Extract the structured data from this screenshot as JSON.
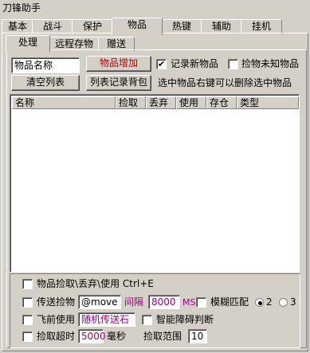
{
  "window": {
    "title": "刀锋助手"
  },
  "main_tabs": [
    "基本",
    "战斗",
    "保护",
    "物品",
    "热键",
    "辅助",
    "挂机"
  ],
  "active_main_tab": "物品",
  "sub_tabs": [
    "处理",
    "远程存物",
    "赠送"
  ],
  "active_sub_tab": "处理",
  "item_panel": {
    "item_name_value": "物品名称",
    "add_item_label": "物品增加",
    "record_new_label": "记录新物品",
    "record_new_checked": true,
    "pickup_unknown_label": "捡物未知物品",
    "pickup_unknown_checked": false,
    "clear_list_label": "清空列表",
    "list_record_bag_label": "列表记录背包",
    "hint_text": "选中物品右键可以删除选中物品"
  },
  "table": {
    "columns": [
      "名称",
      "捡取",
      "丢弃",
      "使用",
      "存仓",
      "类型"
    ],
    "rows": []
  },
  "options": {
    "pickup_discard_use_label": "物品捡取\\丢弃\\使用 Ctrl+E",
    "teleport_pickup_label": "传送捡物",
    "move_cmd_value": "@move",
    "interval_label": "间隔",
    "interval_value": "8000",
    "ms_label": "MS",
    "fuzzy_match_label": "模糊匹配",
    "radio_2_label": "2",
    "radio_3_label": "3",
    "fly_before_use_label": "飞前使用",
    "random_stone_value": "随机传送石",
    "smart_obstacle_label": "智能障碍判断",
    "pickup_timeout_label": "捡取超时",
    "timeout_value": "5000",
    "ms_unit_label": "毫秒",
    "pickup_range_label": "捡取范围",
    "range_value": "10"
  },
  "colors": {
    "red_text": "#c00000",
    "magenta_text": "#a0008a"
  }
}
